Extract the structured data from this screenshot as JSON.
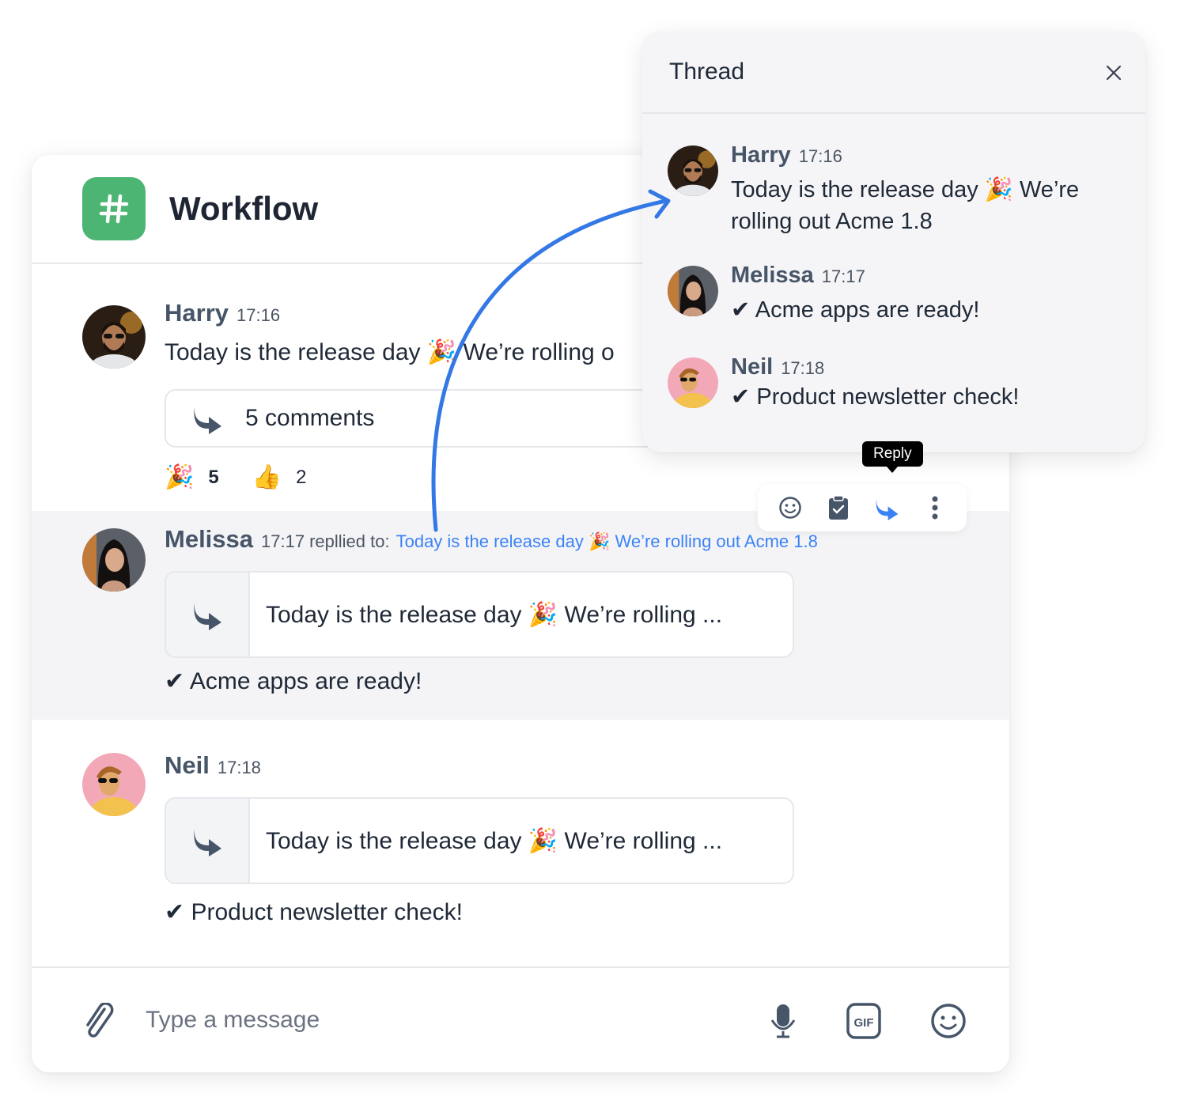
{
  "channel": {
    "icon": "hash-icon",
    "title": "Workflow",
    "accent_color": "#4db574"
  },
  "messages": [
    {
      "author": "Harry",
      "time": "17:16",
      "text": "Today is the release day 🎉 We’re rolling o",
      "comments_label": "5 comments",
      "reactions": [
        {
          "emoji": "🎉",
          "count": "5"
        },
        {
          "emoji": "👍",
          "count": "2"
        }
      ]
    },
    {
      "author": "Melissa",
      "time": "17:17",
      "replied_label": "repllied to:",
      "replied_link": "Today is the release day 🎉 We’re rolling out Acme 1.8",
      "quote": "Today is the release day 🎉 We’re rolling ...",
      "text": "✔ Acme apps are ready!"
    },
    {
      "author": "Neil",
      "time": "17:18",
      "quote": "Today is the release day 🎉 We’re rolling ...",
      "text": "✔ Product newsletter check!"
    }
  ],
  "composer": {
    "placeholder": "Type a message",
    "value": "",
    "icons": [
      "paperclip-icon",
      "microphone-icon",
      "gif-icon",
      "emoji-icon"
    ]
  },
  "thread": {
    "title": "Thread",
    "close_icon": "close-icon",
    "messages": [
      {
        "author": "Harry",
        "time": "17:16",
        "text": "Today is the release day 🎉 We’re rolling out Acme 1.8"
      },
      {
        "author": "Melissa",
        "time": "17:17",
        "text": "✔ Acme apps are ready!"
      },
      {
        "author": "Neil",
        "time": "17:18",
        "text": "✔ Product newsletter check!"
      }
    ]
  },
  "message_actions": {
    "tooltip": "Reply",
    "items": [
      "emoji-react-icon",
      "clipboard-check-icon",
      "reply-icon",
      "more-vertical-icon"
    ],
    "active_color": "#3b82f6"
  },
  "link_color": "#3b82f6"
}
